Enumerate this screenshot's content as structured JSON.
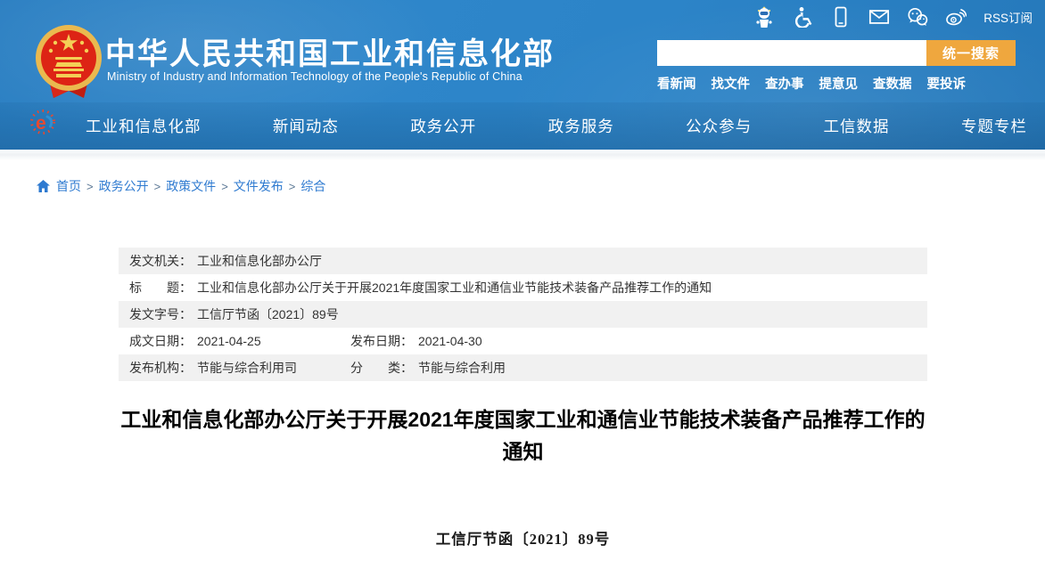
{
  "header": {
    "site_title": "中华人民共和国工业和信息化部",
    "site_subtitle": "Ministry of Industry and Information Technology of the People's Republic of China",
    "rss_label": "RSS订阅",
    "search": {
      "value": "",
      "button_label": "统一搜索"
    },
    "quick_links": [
      "看新闻",
      "找文件",
      "查办事",
      "提意见",
      "查数据",
      "要投诉"
    ]
  },
  "nav": {
    "items": [
      "工业和信息化部",
      "新闻动态",
      "政务公开",
      "政务服务",
      "公众参与",
      "工信数据",
      "专题专栏"
    ]
  },
  "breadcrumb": {
    "items": [
      "首页",
      "政务公开",
      "政策文件",
      "文件发布",
      "综合"
    ],
    "separator": ">"
  },
  "meta": {
    "rows": [
      {
        "label": "发文机关：",
        "value": "工业和信息化部办公厅"
      },
      {
        "label": "标　　题：",
        "value": "工业和信息化部办公厅关于开展2021年度国家工业和通信业节能技术装备产品推荐工作的通知"
      },
      {
        "label": "发文字号：",
        "value": "工信厅节函〔2021〕89号"
      },
      {
        "label": "成文日期：",
        "value": "2021-04-25",
        "label2": "发布日期：",
        "value2": "2021-04-30"
      },
      {
        "label": "发布机构：",
        "value": "节能与综合利用司",
        "label2": "分　　类：",
        "value2": "节能与综合利用"
      }
    ]
  },
  "document": {
    "title": "工业和信息化部办公厅关于开展2021年度国家工业和通信业节能技术装备产品推荐工作的通知",
    "doc_number": "工信厅节函〔2021〕89号"
  },
  "colors": {
    "header_blue": "#2e84c8",
    "nav_band_overlay": "#0a3e6c",
    "search_button_orange": "#efa73e",
    "link_blue": "#2e7ad0",
    "table_row_gray": "#f1f1f1",
    "emblem_gold": "#eab94f",
    "emblem_red": "#dd2415"
  }
}
